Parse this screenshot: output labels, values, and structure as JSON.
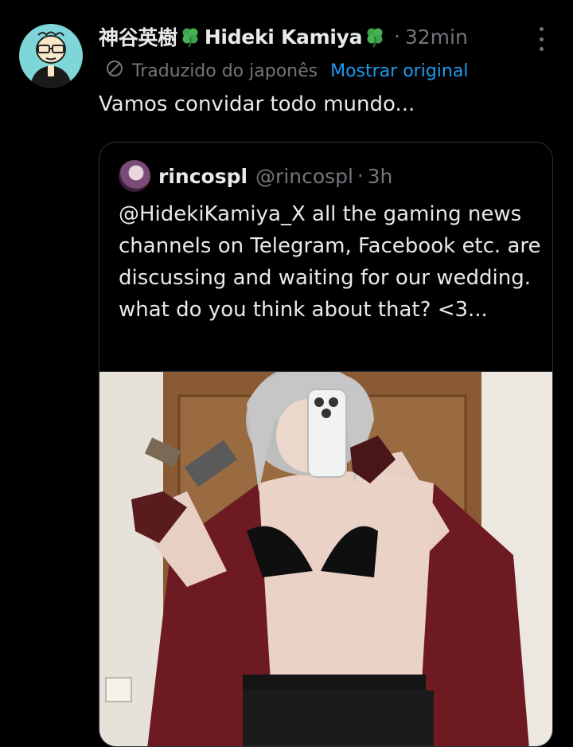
{
  "tweet": {
    "display_name_jp": "神谷英樹",
    "display_name_en": "Hideki Kamiya",
    "time": "32min",
    "translation_label": "Traduzido do japonês",
    "show_original_label": "Mostrar original",
    "text": "Vamos convidar todo mundo..."
  },
  "quote": {
    "name": "rincospl",
    "handle": "@rincospl",
    "time": "3h",
    "text": "@HidekiKamiya_X all the gaming news channels on Telegram, Facebook etc. are discussing and waiting for our wedding. what do you think about that? <3..."
  },
  "icons": {
    "clover": "four-leaf-clover-icon",
    "translate": "translate-icon",
    "more": "more-options-icon"
  },
  "colors": {
    "background": "#000000",
    "text_primary": "#e7e9ea",
    "text_secondary": "#71767b",
    "link": "#1d9bf0",
    "border": "#2f3336",
    "avatar_bg": "#7fd6d8"
  }
}
